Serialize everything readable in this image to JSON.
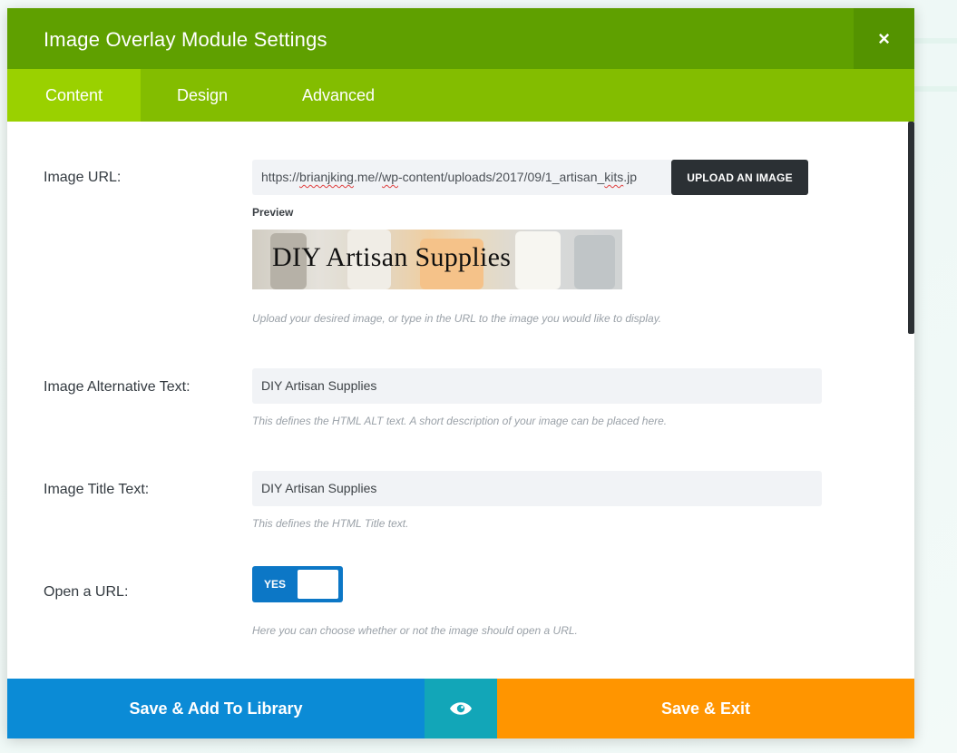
{
  "modal": {
    "title": "Image Overlay Module Settings",
    "close_symbol": "×"
  },
  "tabs": [
    {
      "label": "Content",
      "active": true
    },
    {
      "label": "Design",
      "active": false
    },
    {
      "label": "Advanced",
      "active": false
    }
  ],
  "fields": {
    "image_url": {
      "label": "Image URL:",
      "value_prefix": "https://",
      "value_domain": "brianjking",
      "value_rest_1": ".me//",
      "value_wp": "wp",
      "value_rest_2": "-content/uploads/2017/09/1_artisan_",
      "value_kits": "kits",
      "value_tail": ".jp",
      "upload_button": "UPLOAD AN IMAGE",
      "preview_label": "Preview",
      "preview_image_text": "DIY Artisan Supplies",
      "help": "Upload your desired image, or type in the URL to the image you would like to display."
    },
    "alt_text": {
      "label": "Image Alternative Text:",
      "value": "DIY Artisan Supplies",
      "help": "This defines the HTML ALT text. A short description of your image can be placed here."
    },
    "title_text": {
      "label": "Image Title Text:",
      "value": "DIY Artisan Supplies",
      "help": "This defines the HTML Title text."
    },
    "open_url": {
      "label": "Open a URL:",
      "toggle_label": "YES",
      "toggle_on": true,
      "help": "Here you can choose whether or not the image should open a URL."
    }
  },
  "footer": {
    "save_library": "Save & Add To Library",
    "preview_icon": "eye-icon",
    "save_exit": "Save & Exit"
  },
  "colors": {
    "header": "#5fa000",
    "tabs": "#83bd00",
    "tab_active": "#9ad100",
    "toggle": "#0c77c6",
    "library_button": "#0b8bd6",
    "preview_button": "#12a6b8",
    "exit_button": "#ff9500"
  }
}
